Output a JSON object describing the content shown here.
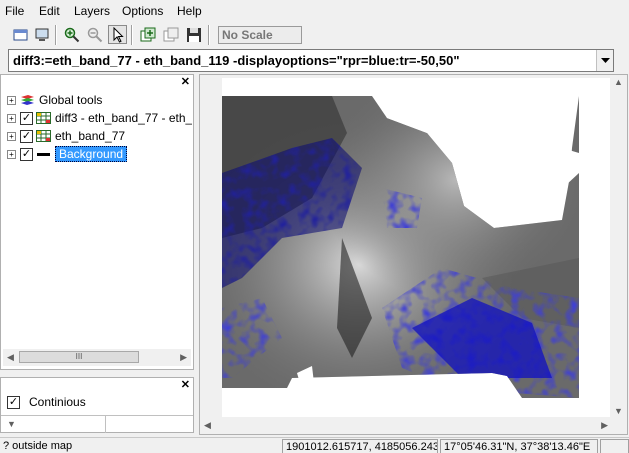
{
  "menubar": {
    "file": "File",
    "edit": "Edit",
    "layers": "Layers",
    "options": "Options",
    "help": "Help"
  },
  "toolbar": {
    "scale_value": "No Scale"
  },
  "command_line": {
    "value": "diff3:=eth_band_77 - eth_band_119 -displayoptions=\"rpr=blue:tr=-50,50\""
  },
  "layers_panel": {
    "items": [
      {
        "label": "Global tools",
        "icon": "global-tools-icon"
      },
      {
        "label": "diff3 - eth_band_77 - eth_",
        "icon": "raster-layer-icon",
        "checked": true
      },
      {
        "label": "eth_band_77",
        "icon": "raster-layer-icon",
        "checked": true
      },
      {
        "label": "Background",
        "icon": "background-line-icon",
        "checked": true,
        "selected": true
      }
    ],
    "scroll_thumb": "III"
  },
  "legend_panel": {
    "item_label": "Continious",
    "checked": true
  },
  "status_bar": {
    "message": "? outside map",
    "coordinates": "1901012.615717, 4185056.243",
    "latlon": "17°05'46.31\"N, 37°38'13.46\"E"
  },
  "colors": {
    "selection": "#3399ff",
    "map_overlay": "#0b0ba8",
    "map_background": "#ffffff"
  }
}
